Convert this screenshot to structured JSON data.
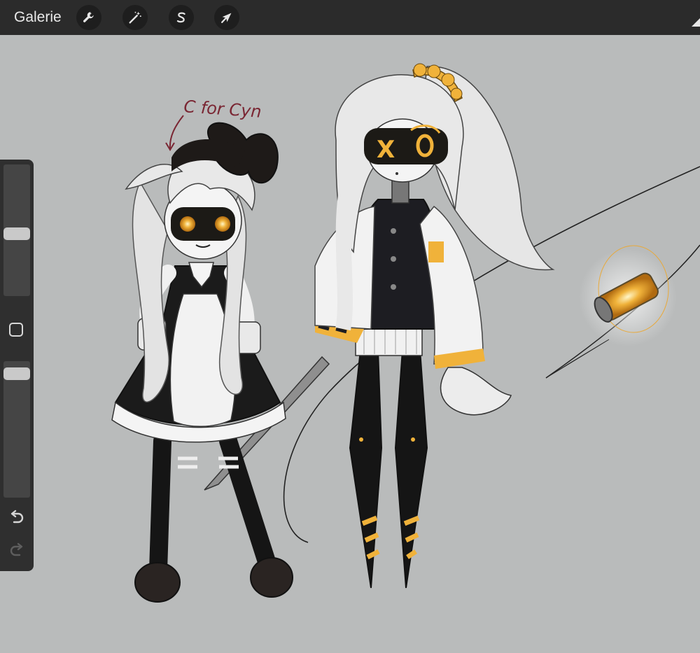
{
  "topbar": {
    "gallery_label": "Galerie",
    "tools": [
      {
        "name": "actions",
        "icon": "wrench-icon"
      },
      {
        "name": "adjustments",
        "icon": "magic-wand-icon"
      },
      {
        "name": "selection",
        "icon": "selection-s-icon"
      },
      {
        "name": "transform",
        "icon": "arrow-cursor-icon"
      }
    ]
  },
  "sidebar": {
    "brush_size": 0.47,
    "opacity": 0.95,
    "undo_icon": "undo-icon",
    "redo_icon": "redo-icon"
  },
  "canvas": {
    "annotation": "C for Cyn",
    "background_color": "#b9bbbb",
    "accent_color": "#f0b23a"
  }
}
